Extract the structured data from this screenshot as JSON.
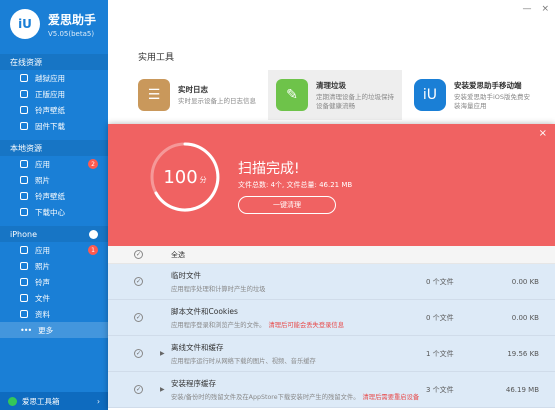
{
  "app": {
    "name": "爱思助手",
    "version": "V5.05(beta5)",
    "logo_text": "iU"
  },
  "window": {
    "minimize": "—",
    "close": "×"
  },
  "sidebar": {
    "sections": [
      {
        "title": "在线资源",
        "items": [
          {
            "label": "越狱应用",
            "icon": "jailbreak-icon"
          },
          {
            "label": "正版应用",
            "icon": "app-icon"
          },
          {
            "label": "铃声壁纸",
            "icon": "ringtone-icon"
          },
          {
            "label": "固件下载",
            "icon": "firmware-icon"
          }
        ]
      },
      {
        "title": "本地资源",
        "items": [
          {
            "label": "应用",
            "badge": "2"
          },
          {
            "label": "照片"
          },
          {
            "label": "铃声壁纸"
          },
          {
            "label": "下载中心"
          }
        ]
      },
      {
        "title": "iPhone",
        "items": [
          {
            "label": "应用",
            "badge": "1"
          },
          {
            "label": "照片"
          },
          {
            "label": "铃声"
          },
          {
            "label": "文件"
          },
          {
            "label": "资料"
          },
          {
            "label": "更多"
          }
        ]
      }
    ],
    "bottom_label": "爱思工具箱",
    "bottom_chevron": "›"
  },
  "tools": {
    "title": "实用工具",
    "items": [
      {
        "name": "实时日志",
        "desc": "实时显示设备上的日志信息",
        "icon": "log-icon",
        "color": "#c9985b"
      },
      {
        "name": "清理垃圾",
        "desc": "定期清理设备上的垃圾保持设备健康流畅",
        "icon": "broom-icon",
        "color": "#6ec34a"
      },
      {
        "name": "安装爱思助手移动端",
        "desc": "安装爱思助手iOS版免费安装海量应用",
        "icon": "iu-app-icon",
        "color": "#1a7fd6"
      }
    ]
  },
  "scan": {
    "close": "×",
    "score": "100",
    "score_unit": "分",
    "title": "扫描完成!",
    "stats": "文件总数: 4个, 文件总量: 46.21 MB",
    "clean_button": "一键清理",
    "select_all": "全选",
    "rows": [
      {
        "name": "临时文件",
        "desc": "应用程序处理和计算时产生的垃圾",
        "warn": "",
        "count": "0 个文件",
        "size": "0.00 KB",
        "expandable": false
      },
      {
        "name": "脚本文件和Cookies",
        "desc": "应用程序登录和浏览产生的文件。",
        "warn": "清理后可能会丢失登录信息",
        "count": "0 个文件",
        "size": "0.00 KB",
        "expandable": false
      },
      {
        "name": "离线文件和缓存",
        "desc": "应用程序运行时从网络下载的图片、视频、音乐缓存",
        "warn": "",
        "count": "1 个文件",
        "size": "19.56 KB",
        "expandable": true
      },
      {
        "name": "安装程序缓存",
        "desc": "安装/备份时的残留文件及在AppStore下载安装时产生的残留文件。",
        "warn": "清理后需要重启设备",
        "count": "3 个文件",
        "size": "46.19 MB",
        "expandable": true
      }
    ]
  },
  "colors": {
    "sidebar": "#1a7fd6",
    "banner": "#f06262",
    "list_row": "#ddeaf7",
    "warn": "#e84a4a"
  }
}
